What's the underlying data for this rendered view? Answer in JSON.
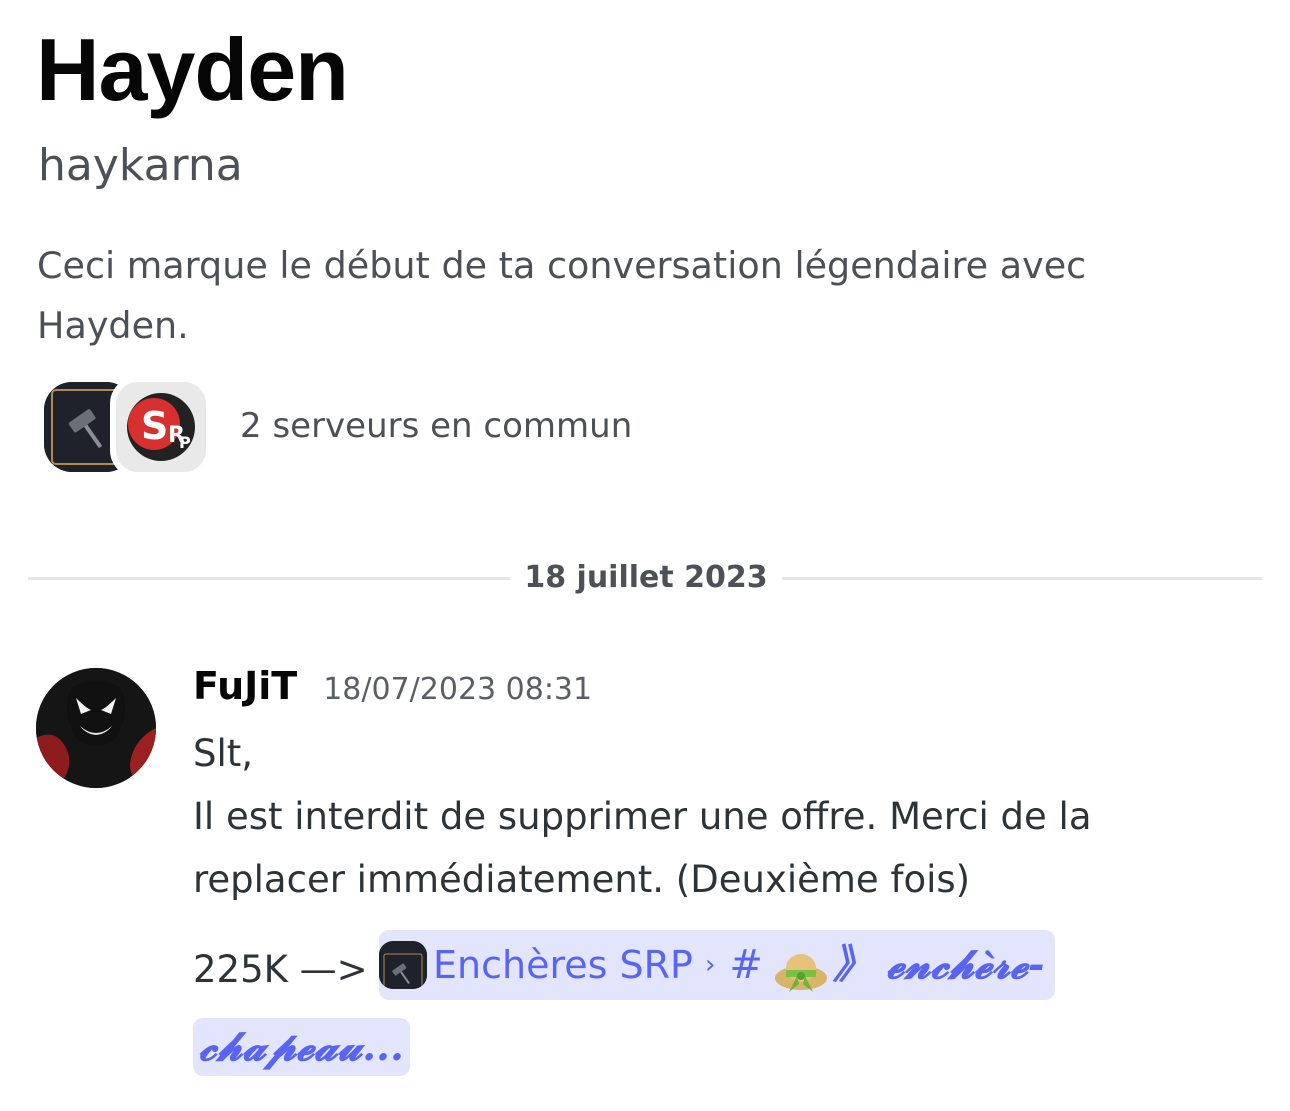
{
  "profile": {
    "display_name": "Hayden",
    "username": "haykarna",
    "intro": "Ceci marque le début de ta conversation légendaire avec Hayden.",
    "mutual_servers_text": "2 serveurs en commun",
    "mutual_server_icons": [
      "auction-gavel-icon",
      "srp-logo-icon"
    ]
  },
  "divider": {
    "date": "18 juillet 2023"
  },
  "message": {
    "author": "FuJiT",
    "timestamp": "18/07/2023 08:31",
    "lines": [
      "Slt,",
      "Il est interdit de supprimer une offre. Merci de la replacer immédiatement. (Deuxième fois)"
    ],
    "offer_prefix": "225K —>",
    "channel_mention": {
      "server": "Enchères SRP",
      "separator": "›",
      "hash": "#",
      "channel_part1": "》 𝓮𝓷𝓬𝓱𝓮̀𝓻𝓮-",
      "channel_part2": "𝓬𝓱𝓪𝓹𝓮𝓪𝓾..."
    }
  },
  "colors": {
    "accent": "#5865f2",
    "mention_bg": "#e3e5fc",
    "muted_text": "#4e5058",
    "divider": "#e3e5e8"
  }
}
